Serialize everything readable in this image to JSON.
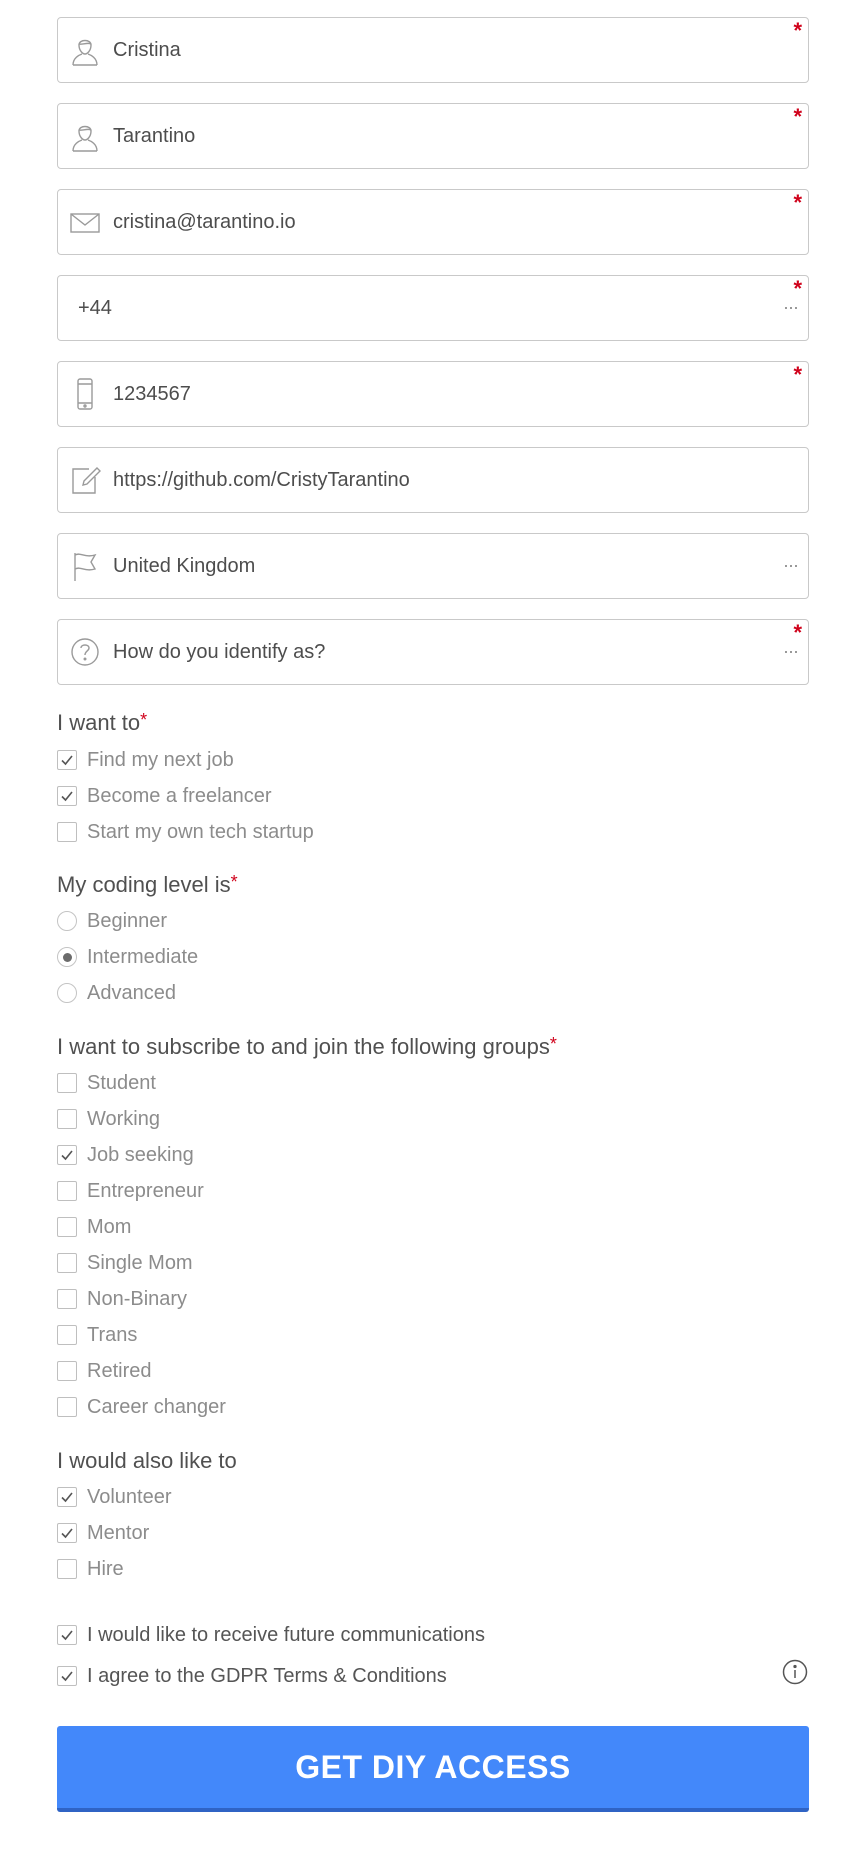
{
  "fields": {
    "first_name": {
      "value": "Cristina",
      "required": true,
      "icon": "user-icon"
    },
    "last_name": {
      "value": "Tarantino",
      "required": true,
      "icon": "user-icon"
    },
    "email": {
      "value": "cristina@tarantino.io",
      "required": true,
      "icon": "envelope-icon"
    },
    "country_code": {
      "value": "+44",
      "required": true,
      "icon": "ellipsis-icon"
    },
    "phone": {
      "value": "1234567",
      "required": true,
      "icon": "mobile-phone-icon"
    },
    "website": {
      "value": "https://github.com/CristyTarantino",
      "required": false,
      "icon": "edit-icon"
    },
    "country": {
      "value": "United Kingdom",
      "required": false,
      "icon": "flag-icon"
    },
    "identity": {
      "value": "How do you identify as?",
      "required": true,
      "icon": "question-circle-icon"
    }
  },
  "required_marker": "*",
  "more_marker": "···",
  "want_to": {
    "title": "I want to",
    "options": [
      {
        "label": "Find my next job",
        "checked": true
      },
      {
        "label": "Become a freelancer",
        "checked": true
      },
      {
        "label": "Start my own tech startup",
        "checked": false
      }
    ]
  },
  "coding_level": {
    "title": "My coding level is",
    "options": [
      {
        "label": "Beginner",
        "checked": false
      },
      {
        "label": "Intermediate",
        "checked": true
      },
      {
        "label": "Advanced",
        "checked": false
      }
    ]
  },
  "groups": {
    "title": "I want to subscribe to and join the following groups",
    "options": [
      {
        "label": "Student",
        "checked": false
      },
      {
        "label": "Working",
        "checked": false
      },
      {
        "label": "Job seeking",
        "checked": true
      },
      {
        "label": "Entrepreneur",
        "checked": false
      },
      {
        "label": "Mom",
        "checked": false
      },
      {
        "label": "Single Mom",
        "checked": false
      },
      {
        "label": "Non-Binary",
        "checked": false
      },
      {
        "label": "Trans",
        "checked": false
      },
      {
        "label": "Retired",
        "checked": false
      },
      {
        "label": "Career changer",
        "checked": false
      }
    ]
  },
  "also_like": {
    "title": "I would also like to",
    "options": [
      {
        "label": "Volunteer",
        "checked": true
      },
      {
        "label": "Mentor",
        "checked": true
      },
      {
        "label": "Hire",
        "checked": false
      }
    ]
  },
  "consents": {
    "communications": {
      "label": "I would like to receive future communications",
      "checked": true
    },
    "gdpr": {
      "label": "I agree to the GDPR Terms & Conditions",
      "checked": true
    }
  },
  "submit_label": "GET DIY ACCESS",
  "colors": {
    "accent": "#4388fa",
    "required": "#d0021b",
    "border": "#c9c9c9"
  }
}
